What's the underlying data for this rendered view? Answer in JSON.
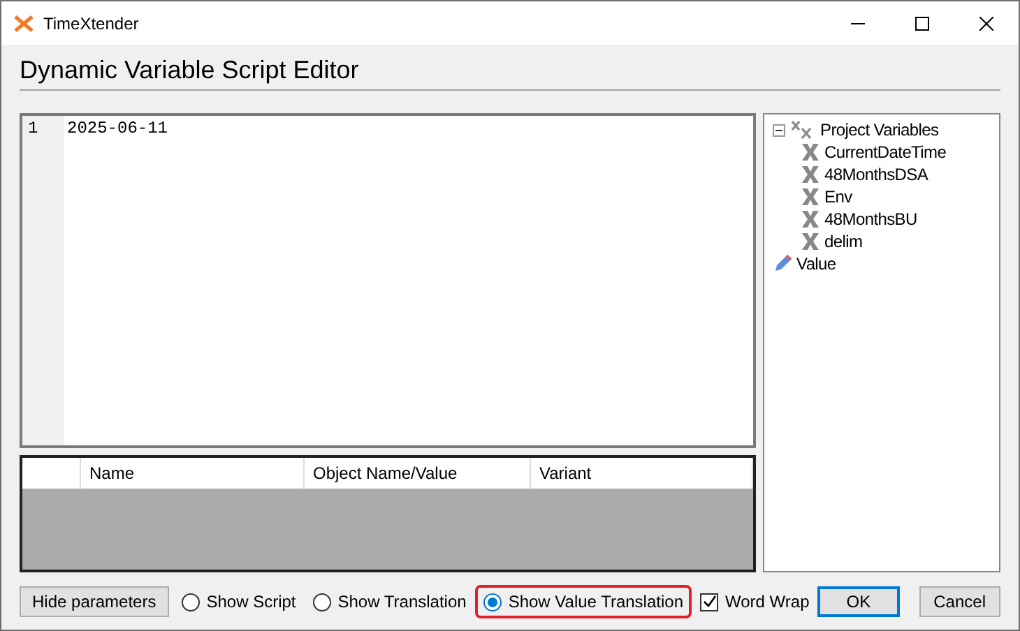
{
  "window": {
    "title": "TimeXtender"
  },
  "heading": "Dynamic Variable Script Editor",
  "editor": {
    "lines": [
      {
        "number": "1",
        "text": "2025-06-11"
      }
    ]
  },
  "parameters_table": {
    "columns": [
      "Name",
      "Object Name/Value",
      "Variant"
    ]
  },
  "tree": [
    {
      "label": "Project Variables",
      "kind": "group",
      "expanded": true,
      "children": [
        {
          "label": "CurrentDateTime",
          "kind": "variable"
        },
        {
          "label": "48MonthsDSA",
          "kind": "variable"
        },
        {
          "label": "Env",
          "kind": "variable"
        },
        {
          "label": "48MonthsBU",
          "kind": "variable"
        },
        {
          "label": "delim",
          "kind": "variable"
        }
      ]
    },
    {
      "label": "Value",
      "kind": "value"
    }
  ],
  "footer": {
    "hide_button": "Hide parameters",
    "modes": [
      {
        "label": "Show Script",
        "selected": false,
        "highlighted": false
      },
      {
        "label": "Show Translation",
        "selected": false,
        "highlighted": false
      },
      {
        "label": "Show Value Translation",
        "selected": true,
        "highlighted": true
      }
    ],
    "word_wrap": {
      "label": "Word Wrap",
      "checked": true
    },
    "buttons": [
      {
        "label": "OK",
        "kind": "default"
      },
      {
        "label": "Cancel",
        "kind": "normal"
      }
    ]
  }
}
